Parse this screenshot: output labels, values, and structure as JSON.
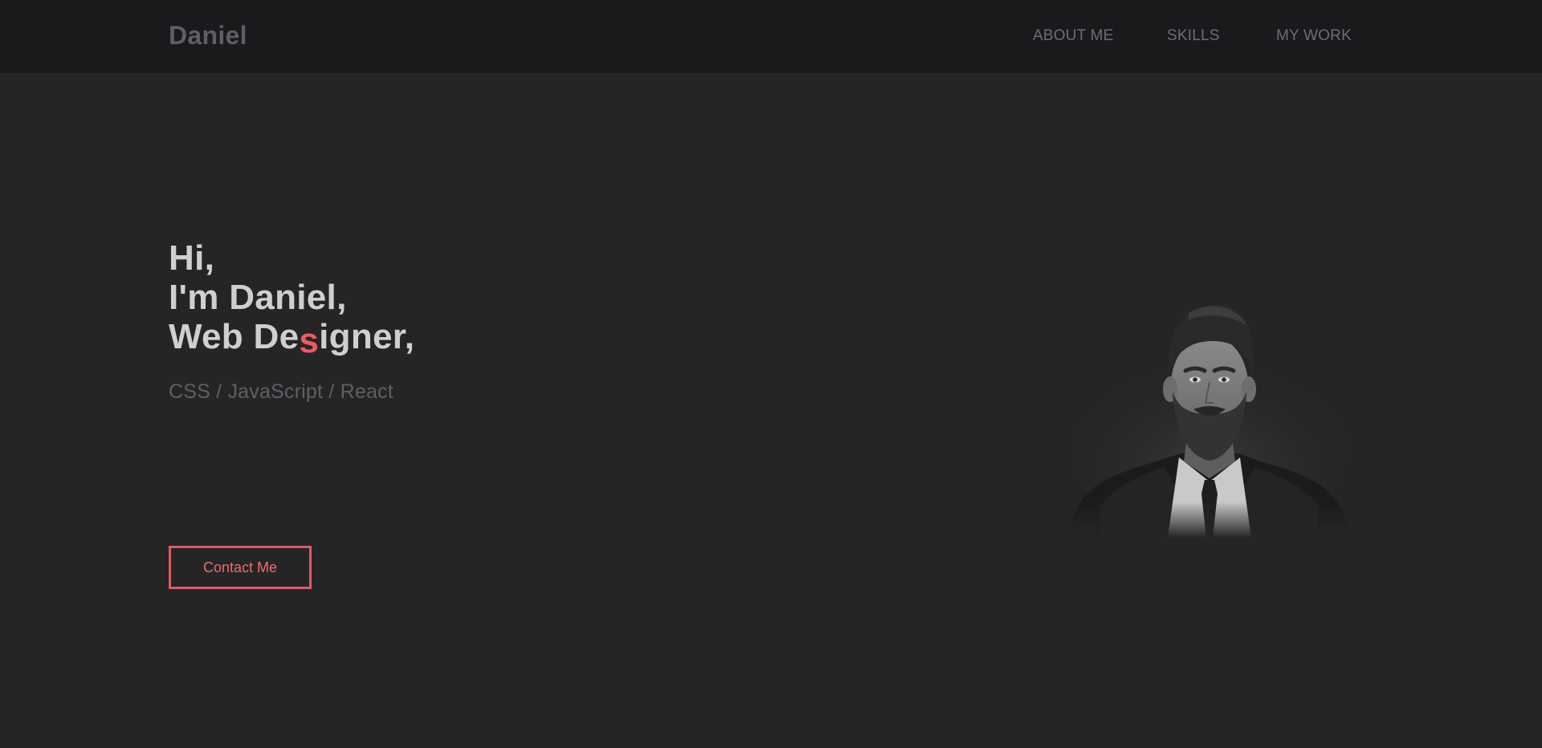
{
  "nav": {
    "logo": "Daniel",
    "links": [
      {
        "label": "ABOUT ME"
      },
      {
        "label": "SKILLS"
      },
      {
        "label": "MY WORK"
      }
    ]
  },
  "hero": {
    "line1": "Hi,",
    "line2": "I'm Daniel,",
    "line3_pre": "Web De",
    "line3_accent": "s",
    "line3_post": "igner,",
    "subtitle": "CSS / JavaScript / React",
    "button_label": "Contact Me",
    "portrait_icon": "portrait-image"
  },
  "colors": {
    "background": "#252526",
    "navbar": "#1a1a1c",
    "accent": "#ef5a5f",
    "heading": "#cfcfcf",
    "muted": "#5f5f66"
  }
}
